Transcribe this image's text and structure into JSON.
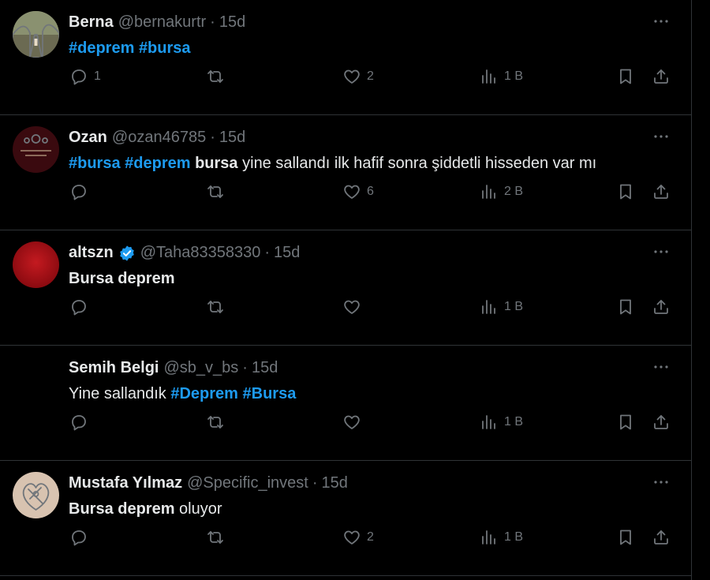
{
  "tweets": [
    {
      "name": "Berna",
      "handle": "@bernakurtr",
      "time": "15d",
      "verified": false,
      "avatar": "photo",
      "segments": [
        {
          "text": "#deprem",
          "style": "hash"
        },
        {
          "text": " ",
          "style": "plain"
        },
        {
          "text": "#bursa",
          "style": "hash"
        }
      ],
      "replies": "1",
      "retweets": "",
      "likes": "2",
      "views": "1 B"
    },
    {
      "name": "Ozan",
      "handle": "@ozan46785",
      "time": "15d",
      "verified": false,
      "avatar": "maroon",
      "segments": [
        {
          "text": "#bursa",
          "style": "hash"
        },
        {
          "text": " ",
          "style": "plain"
        },
        {
          "text": "#deprem",
          "style": "hash"
        },
        {
          "text": " ",
          "style": "plain"
        },
        {
          "text": "bursa",
          "style": "bold"
        },
        {
          "text": " yine sallandı ilk hafif sonra şiddetli hisseden var mı",
          "style": "plain"
        }
      ],
      "replies": "",
      "retweets": "",
      "likes": "6",
      "views": "2 B"
    },
    {
      "name": "altszn",
      "handle": "@Taha83358330",
      "time": "15d",
      "verified": true,
      "avatar": "red",
      "segments": [
        {
          "text": "Bursa deprem",
          "style": "bold"
        }
      ],
      "replies": "",
      "retweets": "",
      "likes": "",
      "views": "1 B"
    },
    {
      "name": "Semih Belgi",
      "handle": "@sb_v_bs",
      "time": "15d",
      "verified": false,
      "avatar": "none",
      "segments": [
        {
          "text": "Yine sallandık ",
          "style": "plain"
        },
        {
          "text": "#Deprem",
          "style": "hash"
        },
        {
          "text": " ",
          "style": "plain"
        },
        {
          "text": "#Bursa",
          "style": "hash"
        }
      ],
      "replies": "",
      "retweets": "",
      "likes": "",
      "views": "1 B"
    },
    {
      "name": "Mustafa Yılmaz",
      "handle": "@Specific_invest",
      "time": "15d",
      "verified": false,
      "avatar": "art",
      "segments": [
        {
          "text": "Bursa deprem",
          "style": "bold"
        },
        {
          "text": " oluyor",
          "style": "plain"
        }
      ],
      "replies": "",
      "retweets": "",
      "likes": "2",
      "views": "1 B"
    }
  ],
  "icons": {
    "reply": "reply-icon",
    "retweet": "retweet-icon",
    "like": "like-icon",
    "views": "views-icon",
    "bookmark": "bookmark-icon",
    "share": "share-icon",
    "more": "more-icon",
    "verified": "verified-badge-icon"
  },
  "colors": {
    "background": "#000000",
    "text": "#e7e9ea",
    "muted": "#71767b",
    "hashtag": "#1d9bf0",
    "divider": "#2f3336"
  }
}
